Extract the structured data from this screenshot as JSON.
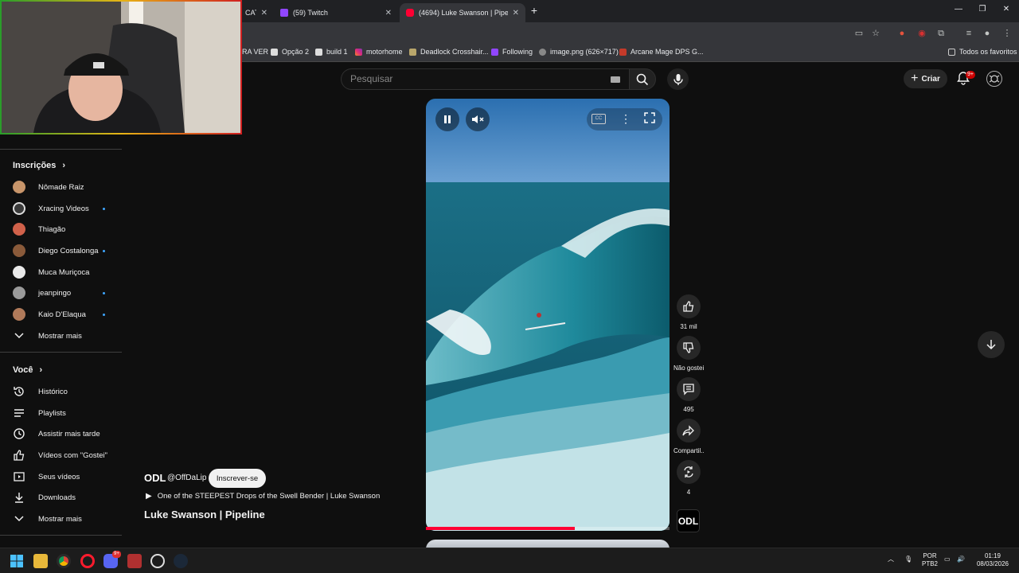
{
  "browser": {
    "tabs": [
      {
        "title": "CAT",
        "active": false
      },
      {
        "title": "(59) Twitch",
        "active": false
      },
      {
        "title": "(4694) Luke Swanson | Pipeline",
        "active": true
      }
    ],
    "new_tab": "+",
    "bookmarks": [
      {
        "label": "RA VER",
        "icon": "folder-icon"
      },
      {
        "label": "Opção 2",
        "icon": "bookmark-icon"
      },
      {
        "label": "build 1",
        "icon": "bookmark-icon"
      },
      {
        "label": "motorhome",
        "icon": "instagram-icon"
      },
      {
        "label": "Deadlock Crosshair...",
        "icon": "deadlock-icon"
      },
      {
        "label": "Following",
        "icon": "twitch-icon"
      },
      {
        "label": "image.png (626×717)",
        "icon": "globe-icon"
      },
      {
        "label": "Arcane Mage DPS G...",
        "icon": "wowhead-icon"
      }
    ],
    "all_bookmarks": "Todos os favoritos"
  },
  "youtube": {
    "search": {
      "placeholder": "Pesquisar"
    },
    "create_label": "Criar",
    "notification_badge": "9+",
    "sidebar": {
      "subscriptions_title": "Inscrições",
      "subscriptions": [
        {
          "name": "Nômade Raiz",
          "new": false,
          "color": "#c8956a"
        },
        {
          "name": "Xracing Videos",
          "new": true,
          "color": "#444"
        },
        {
          "name": "Thiagão",
          "new": false,
          "color": "#d0614a"
        },
        {
          "name": "Diego Costalonga",
          "new": true,
          "color": "#8a5a3a"
        },
        {
          "name": "Muca Muriçoca",
          "new": false,
          "color": "#e9e9e9"
        },
        {
          "name": "jeanpingo",
          "new": true,
          "color": "#9a9a9a"
        },
        {
          "name": "Kaio D'Elaqua",
          "new": true,
          "color": "#b07a5a"
        }
      ],
      "subscriptions_more": "Mostrar mais",
      "you_title": "Você",
      "you_items": [
        {
          "label": "Histórico",
          "icon": "history-icon"
        },
        {
          "label": "Playlists",
          "icon": "playlists-icon"
        },
        {
          "label": "Assistir mais tarde",
          "icon": "watch-later-icon"
        },
        {
          "label": "Vídeos com \"Gostei\"",
          "icon": "thumb-up-icon"
        },
        {
          "label": "Seus vídeos",
          "icon": "your-videos-icon"
        },
        {
          "label": "Downloads",
          "icon": "download-icon"
        }
      ],
      "you_more": "Mostrar mais"
    },
    "short": {
      "channel_logo": "ODL",
      "channel_handle": "@OffDaLip",
      "subscribe_label": "Inscrever-se",
      "related_video": "One of the STEEPEST Drops of the Swell Bender | Luke Swanson",
      "title": "Luke Swanson | Pipeline",
      "progress": 0.61,
      "actions": {
        "likes": "31 mil",
        "dislike": "Não gostei",
        "comments": "495",
        "share": "Compartil...",
        "remix": "4"
      }
    }
  },
  "taskbar": {
    "lang_top": "POR",
    "lang_bottom": "PTB2",
    "time": "01:19",
    "date": "08/03/2026",
    "badge_discord": "9+"
  }
}
